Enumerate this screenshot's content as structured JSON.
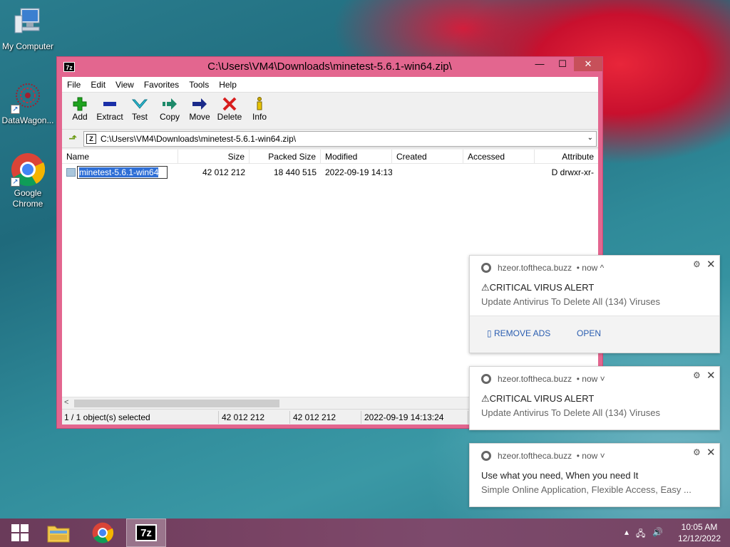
{
  "desktop": {
    "icons": [
      {
        "label": "My Computer",
        "icon": "computer-icon"
      },
      {
        "label": "DataWagon...",
        "icon": "datawagon-icon"
      },
      {
        "label": "Google\nChrome",
        "label_line1": "Google",
        "label_line2": "Chrome",
        "icon": "chrome-icon"
      }
    ]
  },
  "window": {
    "app_icon": "7z",
    "title": "C:\\Users\\VM4\\Downloads\\minetest-5.6.1-win64.zip\\",
    "controls": {
      "minimize": "—",
      "maximize": "☐",
      "close": "✕"
    }
  },
  "menu": [
    "File",
    "Edit",
    "View",
    "Favorites",
    "Tools",
    "Help"
  ],
  "toolbar": [
    {
      "label": "Add",
      "icon": "plus-icon",
      "color": "#1fa31f"
    },
    {
      "label": "Extract",
      "icon": "minus-icon",
      "color": "#1a2fa8"
    },
    {
      "label": "Test",
      "icon": "check-icon",
      "color": "#20a8c8"
    },
    {
      "label": "Copy",
      "icon": "copy-arrow-icon",
      "color": "#1d8a6a"
    },
    {
      "label": "Move",
      "icon": "move-arrow-icon",
      "color": "#1a2a8a"
    },
    {
      "label": "Delete",
      "icon": "x-icon",
      "color": "#d81e1e"
    },
    {
      "label": "Info",
      "icon": "info-icon",
      "color": "#c9a800"
    }
  ],
  "address": {
    "path": "C:\\Users\\VM4\\Downloads\\minetest-5.6.1-win64.zip\\"
  },
  "columns": [
    "Name",
    "Size",
    "Packed Size",
    "Modified",
    "Created",
    "Accessed",
    "Attribute"
  ],
  "rows": [
    {
      "name": "minetest-5.6.1-win64",
      "size": "42 012 212",
      "packed": "18 440 515",
      "modified": "2022-09-19 14:13",
      "created": "",
      "accessed": "",
      "attr": "D drwxr-xr-"
    }
  ],
  "status": {
    "selected": "1 / 1 object(s) selected",
    "size": "42 012 212",
    "packed": "42 012 212",
    "modified": "2022-09-19 14:13:24"
  },
  "notifications": [
    {
      "source": "hzeor.toftheca.buzz",
      "time": "• now ^",
      "title": "⚠CRITICAL VIRUS ALERT",
      "body": "Update Antivirus To Delete All (134) Viruses",
      "actions": [
        "▯ REMOVE ADS",
        "OPEN"
      ]
    },
    {
      "source": "hzeor.toftheca.buzz",
      "time": "• now ˅",
      "title": "⚠CRITICAL VIRUS ALERT",
      "body": "Update Antivirus To Delete All (134) Viruses"
    },
    {
      "source": "hzeor.toftheca.buzz",
      "time": "• now ˅",
      "title": "Use what you need, When you need It",
      "body": "Simple Online Application, Flexible Access, Easy ..."
    }
  ],
  "taskbar": {
    "time": "10:05 AM",
    "date": "12/12/2022"
  }
}
